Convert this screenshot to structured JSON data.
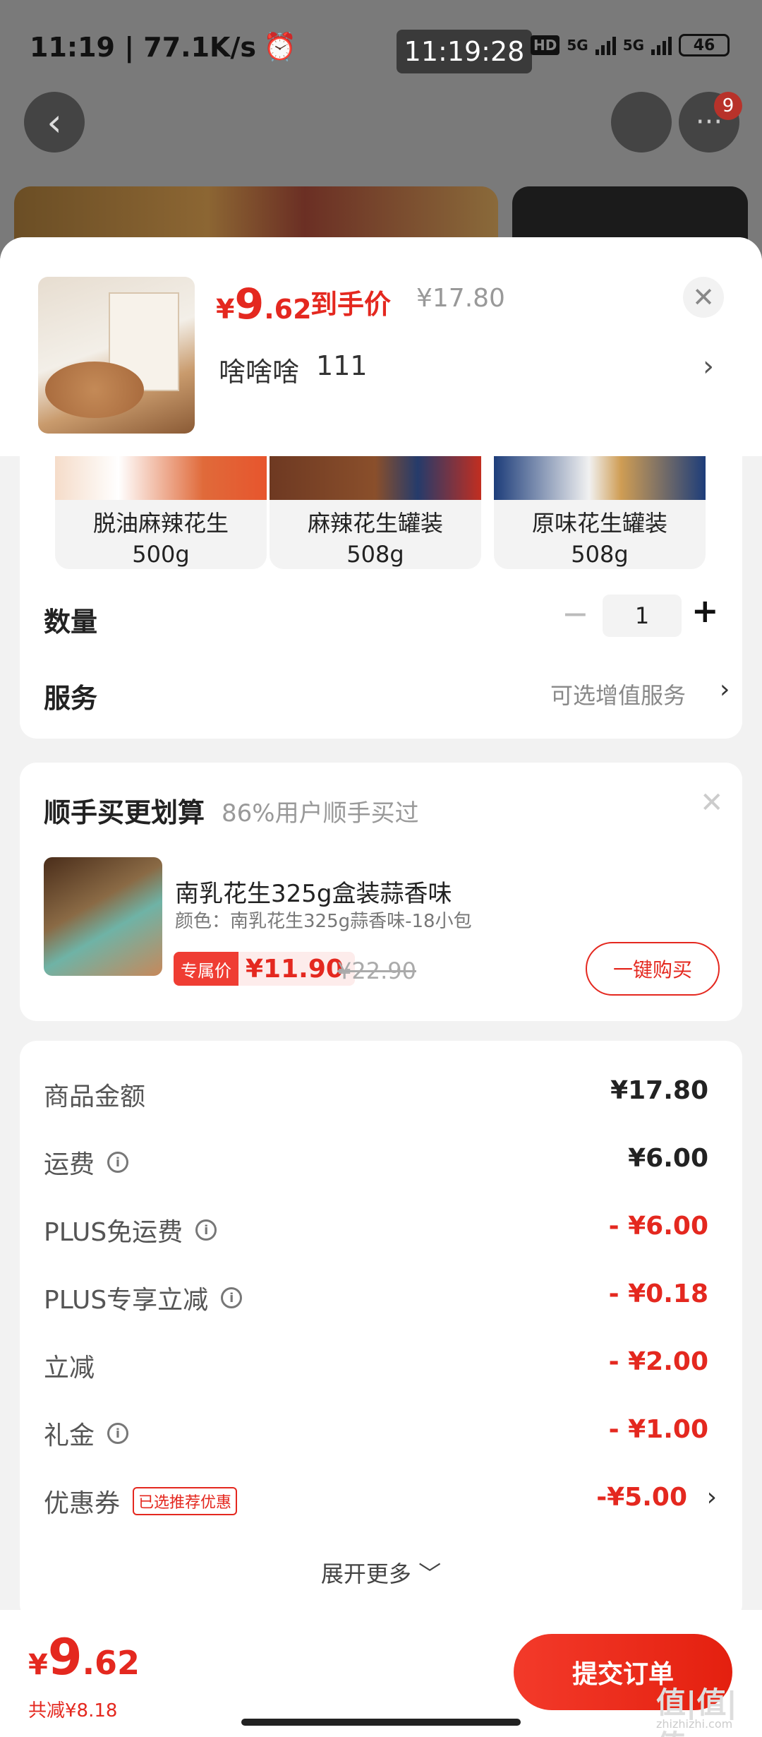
{
  "status_bar": {
    "time_speed": "11:19 | 77.1K/s",
    "clock": "11:19:28",
    "hd": "HD",
    "net1": "5G",
    "net2": "5G",
    "battery": "46"
  },
  "bg_nav": {
    "back_icon": "chevron-left-icon",
    "share_icon": "share-icon",
    "more_icon": "more-icon",
    "badge": "9"
  },
  "header": {
    "price_currency": "¥",
    "price_int": "9",
    "price_dec": ".62",
    "price_tag": "到手价",
    "original_price": "¥17.80",
    "variant_name": "啥啥啥",
    "variant_code": "111",
    "close_icon": "close-icon"
  },
  "options": [
    {
      "name": "脱油麻辣花生",
      "weight": "500g"
    },
    {
      "name": "麻辣花生罐装",
      "weight": "508g"
    },
    {
      "name": "原味花生罐装",
      "weight": "508g"
    }
  ],
  "quantity": {
    "label": "数量",
    "minus": "−",
    "value": "1",
    "plus": "+"
  },
  "service": {
    "label": "服务",
    "value": "可选增值服务",
    "chevron": "›"
  },
  "addon": {
    "title": "顺手买更划算",
    "subtitle": "86%用户顺手买过",
    "name": "南乳花生325g盒装蒜香味",
    "spec": "颜色：南乳花生325g蒜香味-18小包",
    "badge": "专属价",
    "price": "¥11.90",
    "orig_price": "¥22.90",
    "buy_label": "一键购买"
  },
  "fees": [
    {
      "label": "商品金额",
      "value": "¥17.80",
      "info": false,
      "red": false
    },
    {
      "label": "运费",
      "value": "¥6.00",
      "info": true,
      "red": false
    },
    {
      "label": "PLUS免运费",
      "value": "- ¥6.00",
      "info": true,
      "red": true
    },
    {
      "label": "PLUS专享立减",
      "value": "- ¥0.18",
      "info": true,
      "red": true
    },
    {
      "label": "立减",
      "value": "- ¥2.00",
      "info": false,
      "red": true
    },
    {
      "label": "礼金",
      "value": "- ¥1.00",
      "info": true,
      "red": true
    }
  ],
  "coupon": {
    "label": "优惠券",
    "tag": "已选推荐优惠",
    "value": "-¥5.00",
    "chevron": "›"
  },
  "expand": "展开更多 ﹀",
  "footer": {
    "currency": "¥",
    "int": "9",
    "dec": ".62",
    "saved": "共减¥8.18",
    "submit": "提交订单"
  },
  "watermark": {
    "logo": "值|值|值",
    "url": "zhizhizhi.com"
  }
}
